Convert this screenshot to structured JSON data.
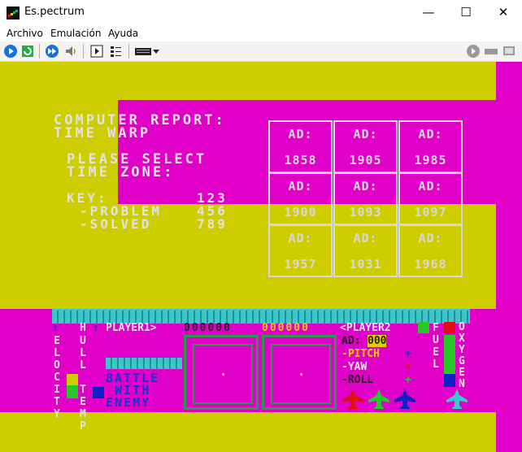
{
  "window": {
    "title": "Es.pectrum",
    "minimize_glyph": "—",
    "maximize_glyph": "☐",
    "close_glyph": "✕"
  },
  "menu": {
    "items": [
      "Archivo",
      "Emulación",
      "Ayuda"
    ]
  },
  "toolbar": {
    "icons": [
      "open-icon",
      "reset-icon",
      "fast-forward-icon",
      "sound-icon",
      "play-icon",
      "settings-icon",
      "keyboard-icon",
      "chevron-down-icon",
      "record-icon",
      "tape-icon",
      "screen-icon"
    ]
  },
  "colors": {
    "yellow": "#cdcd00",
    "magenta": "#e000c8",
    "cyan": "#3cc8c8",
    "green": "#28c828",
    "red": "#e01010",
    "blue": "#1020c8",
    "white": "#e2e2e2"
  },
  "game": {
    "report_title": "COMPUTER REPORT:",
    "report_subtitle": "TIME WARP",
    "select_line1": "PLEASE SELECT",
    "select_line2": "TIME ZONE:",
    "key_label": "KEY:",
    "key_value": "123",
    "problem_label": "-PROBLEM",
    "problem_value": "456",
    "solved_label": "-SOLVED",
    "solved_value": "789",
    "ad_label": "AD:",
    "years": [
      "1858",
      "1905",
      "1985",
      "1900",
      "1093",
      "1097",
      "1957",
      "1031",
      "1968"
    ]
  },
  "hud": {
    "player1": "PLAYER1>",
    "player2": "<PLAYER2",
    "counter1": "000000",
    "counter2": "000000",
    "left_col": [
      "V",
      "E",
      "L",
      "O",
      "C",
      "I",
      "T",
      "Y"
    ],
    "hull_col": [
      "H",
      "U",
      "L",
      "L",
      "",
      "T",
      "E",
      "M",
      "P"
    ],
    "right_col": [
      "F",
      "U",
      "E",
      "L"
    ],
    "right_col2": [
      "O",
      "X",
      "Y",
      "G",
      "E",
      "N"
    ],
    "score_prefix": "AD:",
    "score_value": "000",
    "pitch": "-PITCH",
    "yaw": "-YAW",
    "roll": "-ROLL",
    "message_lines": [
      "BATTLE",
      "WITH",
      "ENEMY"
    ]
  }
}
